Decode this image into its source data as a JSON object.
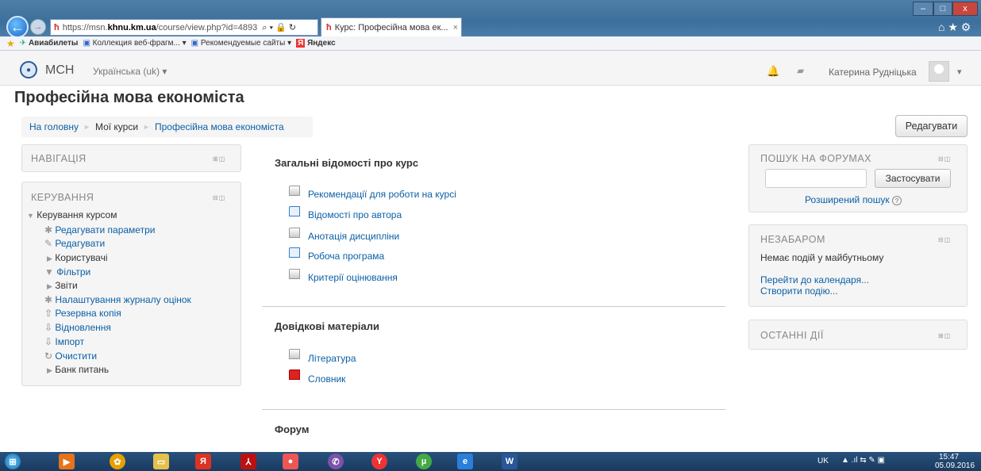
{
  "browser": {
    "url_prefix": "https://msn.",
    "url_domain": "khnu.km.ua",
    "url_path": "/course/view.php?id=4893",
    "url_controls": "⌕ ▾ 🔒 ↻",
    "tab_title": "Курс: Професійна мова ек...",
    "tab_close": "×",
    "icons_right": "⌂ ★ ⚙",
    "window_minimize": "–",
    "window_maximize": "□",
    "window_close": "x"
  },
  "favorites": [
    {
      "label": "Авиабилеты"
    },
    {
      "label": "Коллекция веб-фрагм... ▾"
    },
    {
      "label": "Рекомендуемые сайты ▾"
    },
    {
      "label": "Яндекс"
    }
  ],
  "header": {
    "site_name": "МСН",
    "language": "Українська (uk) ▾",
    "user": "Катерина Рудніцька",
    "user_menu": "▾"
  },
  "page": {
    "title": "Професійна мова економіста",
    "edit_button": "Редагувати"
  },
  "breadcrumb": {
    "home": "На головну",
    "sep": "►",
    "my_courses": "Мої курси",
    "current": "Професійна мова економіста"
  },
  "navigation": {
    "title": "НАВІГАЦІЯ"
  },
  "admin": {
    "title": "КЕРУВАННЯ",
    "root": "Керування курсом",
    "items": [
      {
        "label": "Редагувати параметри",
        "icon": "gear-icon"
      },
      {
        "label": "Редагувати",
        "icon": "pencil-icon"
      },
      {
        "label": "Користувачі",
        "icon": "arrow-icon"
      },
      {
        "label": "Фільтри",
        "icon": "filter-icon"
      },
      {
        "label": "Звіти",
        "icon": "arrow-icon"
      },
      {
        "label": "Налаштування журналу оцінок",
        "icon": "gear-icon"
      },
      {
        "label": "Резервна копія",
        "icon": "upload-icon"
      },
      {
        "label": "Відновлення",
        "icon": "download-icon"
      },
      {
        "label": "Імпорт",
        "icon": "download-icon"
      },
      {
        "label": "Очистити",
        "icon": "reset-icon"
      },
      {
        "label": "Банк питань",
        "icon": "arrow-icon"
      }
    ]
  },
  "sections": [
    {
      "title": "Загальні відомості про курс",
      "activities": [
        {
          "label": "Рекомендації для роботи на курсі",
          "type": "file"
        },
        {
          "label": "Відомості про автора",
          "type": "page"
        },
        {
          "label": "Анотація дисципліни",
          "type": "file"
        },
        {
          "label": "Робоча програма",
          "type": "page"
        },
        {
          "label": "Критерії оцінювання",
          "type": "file"
        }
      ]
    },
    {
      "title": "Довідкові матеріали",
      "activities": [
        {
          "label": "Література",
          "type": "file"
        },
        {
          "label": "Словник",
          "type": "glossary"
        }
      ]
    },
    {
      "title": "Форум",
      "activities": []
    }
  ],
  "forum_search": {
    "title": "ПОШУК НА ФОРУМАХ",
    "button": "Застосувати",
    "advanced": "Розширений пошук",
    "help": "?"
  },
  "upcoming": {
    "title": "НЕЗАБАРОМ",
    "empty": "Немає подій у майбутньому",
    "go_calendar": "Перейти до календаря...",
    "new_event": "Створити подію..."
  },
  "recent": {
    "title": "ОСТАННІ ДІЇ"
  },
  "taskbar": {
    "lang": "UK",
    "time": "15:47",
    "date": "05.09.2016",
    "tray": "▲ .ıl ⇆ ✎ ▣"
  },
  "colors": {
    "link": "#0b5fa5",
    "taskbar": "#1a3a60"
  }
}
